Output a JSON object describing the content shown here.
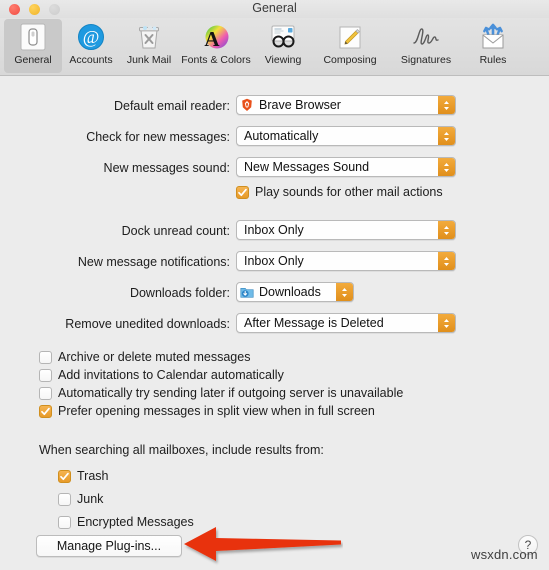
{
  "window": {
    "title": "General",
    "controls": [
      {
        "name": "close",
        "color": "#f14c42"
      },
      {
        "name": "minimize",
        "color": "#f0b429"
      },
      {
        "name": "zoom",
        "color": "#cccccc"
      }
    ]
  },
  "toolbar": {
    "items": [
      {
        "label": "General",
        "icon": "general-icon",
        "selected": true
      },
      {
        "label": "Accounts",
        "icon": "accounts-at-icon",
        "selected": false
      },
      {
        "label": "Junk Mail",
        "icon": "junk-mail-icon",
        "selected": false
      },
      {
        "label": "Fonts & Colors",
        "icon": "fonts-colors-icon",
        "selected": false
      },
      {
        "label": "Viewing",
        "icon": "viewing-icon",
        "selected": false
      },
      {
        "label": "Composing",
        "icon": "composing-icon",
        "selected": false
      },
      {
        "label": "Signatures",
        "icon": "signatures-icon",
        "selected": false
      },
      {
        "label": "Rules",
        "icon": "rules-icon",
        "selected": false
      }
    ]
  },
  "form": {
    "default_email_reader": {
      "label": "Default email reader:",
      "value": "Brave Browser",
      "icon": "brave-browser-icon"
    },
    "check_new_messages": {
      "label": "Check for new messages:",
      "value": "Automatically"
    },
    "new_messages_sound": {
      "label": "New messages sound:",
      "value": "New Messages Sound"
    },
    "play_sounds": {
      "label": "Play sounds for other mail actions",
      "checked": true
    },
    "dock_unread_count": {
      "label": "Dock unread count:",
      "value": "Inbox Only"
    },
    "new_message_notifications": {
      "label": "New message notifications:",
      "value": "Inbox Only"
    },
    "downloads_folder": {
      "label": "Downloads folder:",
      "value": "Downloads",
      "icon": "downloads-folder-icon"
    },
    "remove_unedited_downloads": {
      "label": "Remove unedited downloads:",
      "value": "After Message is Deleted"
    }
  },
  "options": [
    {
      "label": "Archive or delete muted messages",
      "checked": false
    },
    {
      "label": "Add invitations to Calendar automatically",
      "checked": false
    },
    {
      "label": "Automatically try sending later if outgoing server is unavailable",
      "checked": false
    },
    {
      "label": "Prefer opening messages in split view when in full screen",
      "checked": true
    }
  ],
  "search_section": {
    "heading": "When searching all mailboxes, include results from:",
    "items": [
      {
        "label": "Trash",
        "checked": true
      },
      {
        "label": "Junk",
        "checked": false
      },
      {
        "label": "Encrypted Messages",
        "checked": false
      }
    ]
  },
  "footer": {
    "manage_plugins_label": "Manage Plug-ins...",
    "help_label": "?",
    "watermark": "wsxdn.com"
  },
  "annotation": {
    "type": "red-arrow",
    "points_to": "Manage Plug-ins...",
    "color": "#e8320f"
  }
}
